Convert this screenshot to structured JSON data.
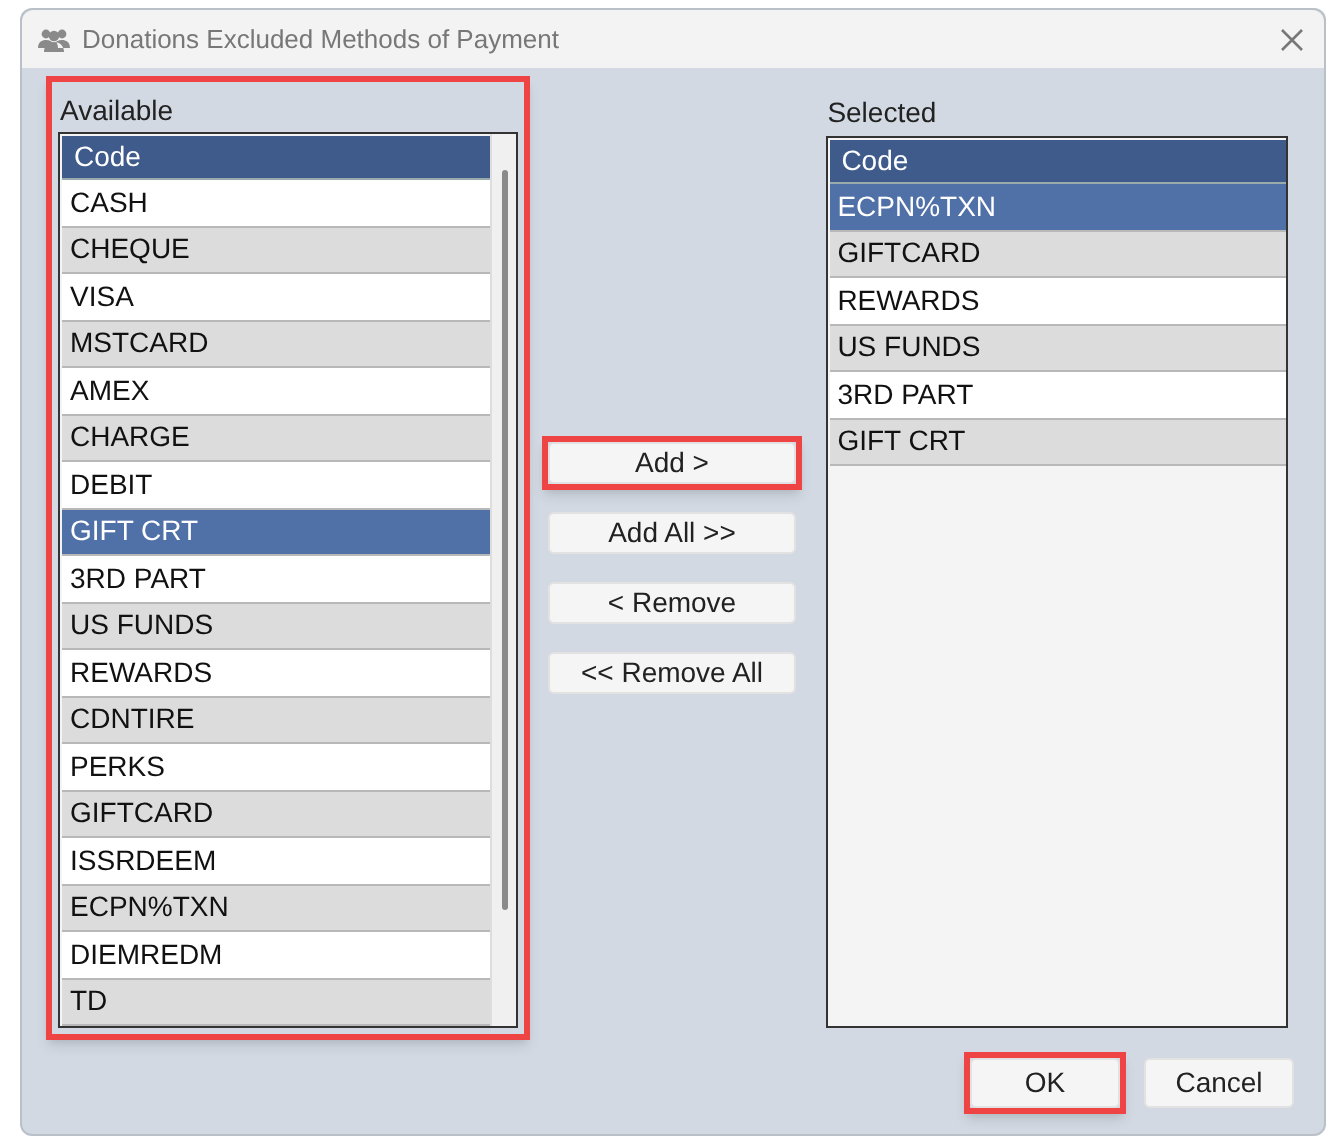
{
  "window": {
    "title": "Donations Excluded Methods of Payment"
  },
  "available": {
    "label": "Available",
    "highlighted": true,
    "column": "Code",
    "rows": [
      {
        "label": "CASH",
        "selected": false
      },
      {
        "label": "CHEQUE",
        "selected": false
      },
      {
        "label": "VISA",
        "selected": false
      },
      {
        "label": "MSTCARD",
        "selected": false
      },
      {
        "label": "AMEX",
        "selected": false
      },
      {
        "label": "CHARGE",
        "selected": false
      },
      {
        "label": "DEBIT",
        "selected": false
      },
      {
        "label": "GIFT CRT",
        "selected": true
      },
      {
        "label": "3RD PART",
        "selected": false
      },
      {
        "label": "US FUNDS",
        "selected": false
      },
      {
        "label": "REWARDS",
        "selected": false
      },
      {
        "label": "CDNTIRE",
        "selected": false
      },
      {
        "label": "PERKS",
        "selected": false
      },
      {
        "label": "GIFTCARD",
        "selected": false
      },
      {
        "label": "ISSRDEEM",
        "selected": false
      },
      {
        "label": "ECPN%TXN",
        "selected": false
      },
      {
        "label": "DIEMREDM",
        "selected": false
      },
      {
        "label": "TD",
        "selected": false
      }
    ]
  },
  "transfer_buttons": [
    {
      "label": "Add >",
      "highlighted": true
    },
    {
      "label": "Add All >>",
      "highlighted": false
    },
    {
      "label": "< Remove",
      "highlighted": false
    },
    {
      "label": "<< Remove All",
      "highlighted": false
    }
  ],
  "selected": {
    "label": "Selected",
    "highlighted": false,
    "column": "Code",
    "rows": [
      {
        "label": "ECPN%TXN",
        "selected": true
      },
      {
        "label": "GIFTCARD",
        "selected": false
      },
      {
        "label": "REWARDS",
        "selected": false
      },
      {
        "label": "US FUNDS",
        "selected": false
      },
      {
        "label": "3RD PART",
        "selected": false
      },
      {
        "label": "GIFT CRT",
        "selected": false
      }
    ]
  },
  "footer_buttons": [
    {
      "label": "OK",
      "highlighted": true
    },
    {
      "label": "Cancel",
      "highlighted": false
    }
  ]
}
